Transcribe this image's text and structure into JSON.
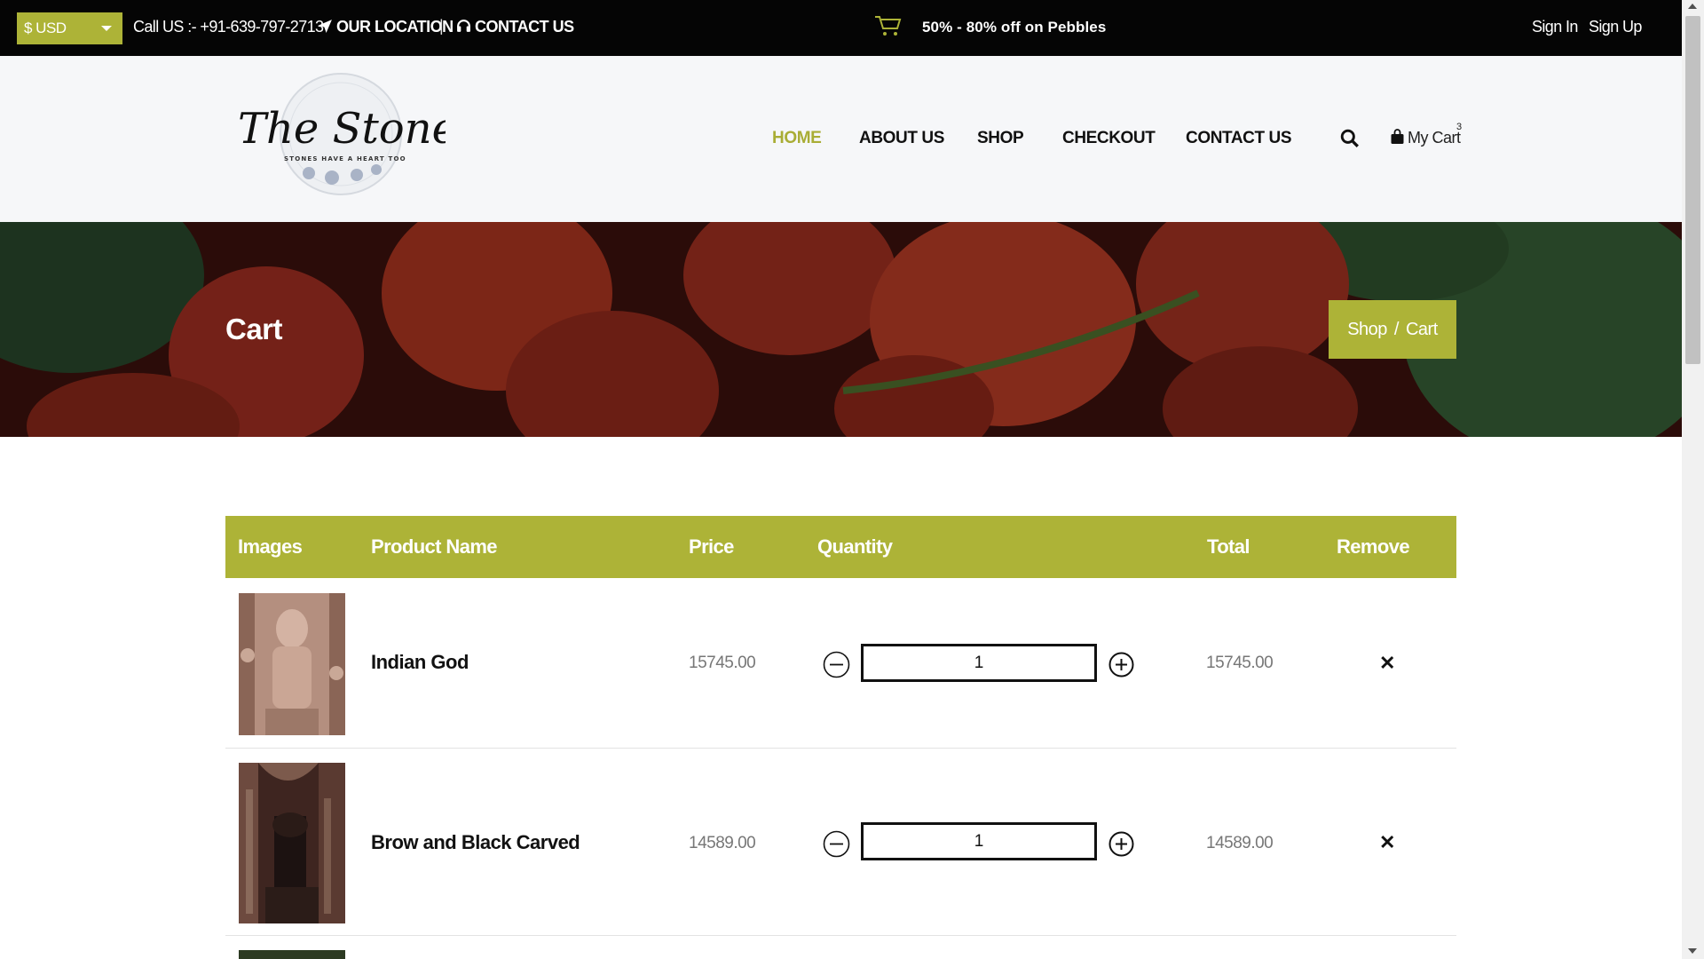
{
  "topbar": {
    "currency": "$ USD",
    "call_us": "Call US :- +91-639-797-2713",
    "our_location": "OUR LOCATION",
    "separator": "|",
    "contact_us": "CONTACT US",
    "promo": "50% - 80% off on Pebbles",
    "sign_in": "Sign In",
    "sign_up": "Sign Up"
  },
  "header": {
    "logo_text": "The Stone Shop",
    "logo_tagline": "STONES HAVE A HEART TOO",
    "nav": [
      "HOME",
      "ABOUT US",
      "SHOP",
      "CHECKOUT",
      "CONTACT US"
    ],
    "active_nav": "HOME",
    "cart_label": "My Cart",
    "cart_count": "3"
  },
  "banner": {
    "title": "Cart",
    "breadcrumb": [
      "Shop",
      "Cart"
    ],
    "breadcrumb_separator": "/"
  },
  "cart_table": {
    "headers": [
      "Images",
      "Product Name",
      "Price",
      "Quantity",
      "Total",
      "Remove"
    ],
    "rows": [
      {
        "name": "Indian God",
        "price": "15745.00",
        "quantity": "1",
        "total": "15745.00",
        "remove": "✕"
      },
      {
        "name": "Brow and Black Carved",
        "price": "14589.00",
        "quantity": "1",
        "total": "14589.00",
        "remove": "✕"
      }
    ]
  },
  "colors": {
    "accent": "#adb337",
    "topbar_bg": "#050505",
    "header_bg": "#f6f7f9",
    "active_nav": "#a9ad35"
  },
  "icons": [
    "cart-icon",
    "paper-plane-icon",
    "headset-icon",
    "search-icon",
    "shopping-bag-icon",
    "minus-circle-icon",
    "plus-circle-icon",
    "close-icon"
  ]
}
